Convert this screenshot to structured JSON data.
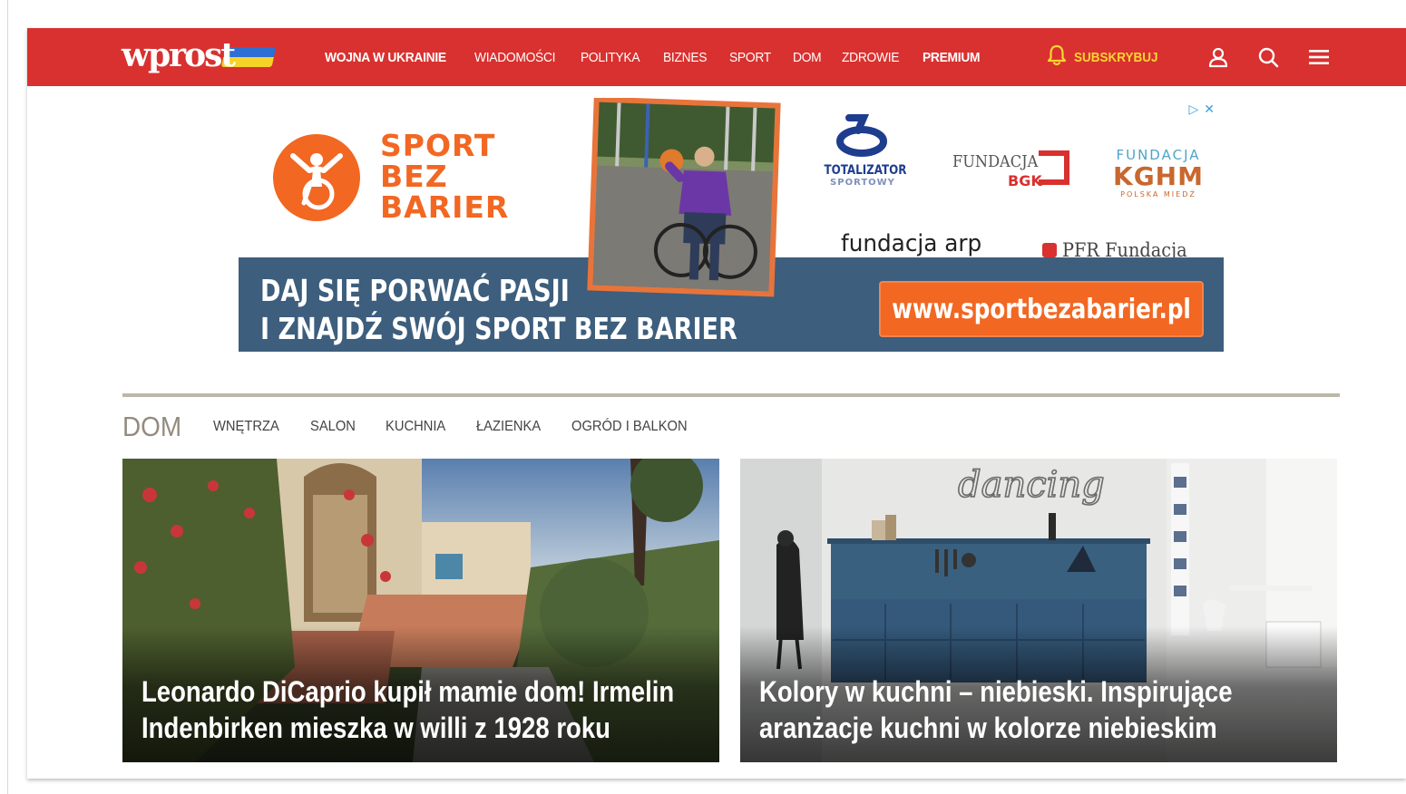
{
  "brand": {
    "logo_text": "wprost",
    "colors": {
      "nav_bg": "#d8312f",
      "accent_yellow": "#f8d531",
      "flag_blue": "#2d6fd3",
      "flag_yellow": "#f5d327"
    }
  },
  "nav": {
    "items": [
      {
        "label": "WOJNA W UKRAINIE",
        "bold": true
      },
      {
        "label": "WIADOMOŚCI",
        "bold": false
      },
      {
        "label": "POLITYKA",
        "bold": false
      },
      {
        "label": "BIZNES",
        "bold": false
      },
      {
        "label": "SPORT",
        "bold": false
      },
      {
        "label": "DOM",
        "bold": false
      },
      {
        "label": "ZDROWIE",
        "bold": false
      },
      {
        "label": "PREMIUM",
        "bold": true
      }
    ],
    "subscribe_label": "SUBSKRYBUJ",
    "icons": [
      "bell-icon",
      "user-icon",
      "search-icon",
      "menu-icon"
    ]
  },
  "ad": {
    "brand_lines": [
      "SPORT",
      "BEZ",
      "BARIER"
    ],
    "slogan_lines": [
      "DAJ SIĘ PORWAĆ PASJI",
      "I ZNAJDŹ SWÓJ SPORT BEZ BARIER"
    ],
    "url": "www.sportbezabarier.pl",
    "sponsors": {
      "totalizator_main": "TOTALIZATOR",
      "totalizator_sub": "SPORTOWY",
      "bgk_word": "FUNDACJA",
      "bgk_sub": "BGK",
      "kghm_top": "FUNDACJA",
      "kghm_main": "KGHM",
      "kghm_sub": "POLSKA MIEDŹ",
      "arp": "fundacja arp",
      "pfr": "PFR Fundacja"
    },
    "colors": {
      "orange": "#f26722",
      "band": "#3d5e7d"
    }
  },
  "section": {
    "title": "DOM",
    "items": [
      "WNĘTRZA",
      "SALON",
      "KUCHNIA",
      "ŁAZIENKA",
      "OGRÓD I BALKON"
    ]
  },
  "articles": [
    {
      "title": "Leonardo DiCaprio kupił mamie dom! Irmelin Indenbirken mieszka w willi z 1928 roku"
    },
    {
      "title": "Kolory w kuchni – niebieski. Inspirujące aranżacje kuchni w kolorze niebieskim"
    }
  ],
  "kitchen_sign": "dancing"
}
